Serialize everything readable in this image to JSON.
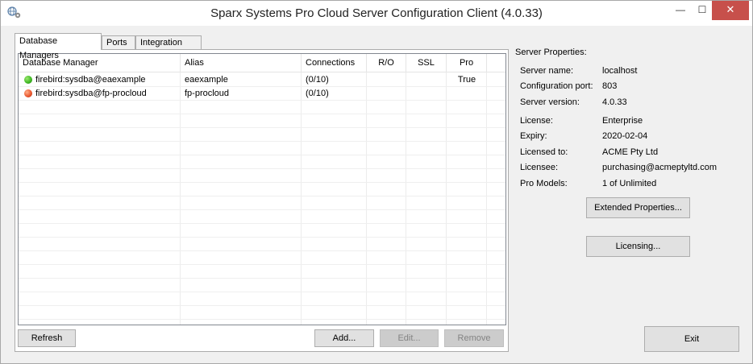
{
  "window": {
    "title": "Sparx Systems Pro Cloud Server Configuration Client (4.0.33)",
    "controls": {
      "minimize": "—",
      "maximize": "☐",
      "close": "✕"
    },
    "app_icon": "gear-globe-icon"
  },
  "tabs": [
    {
      "label": "Database Managers",
      "active": true
    },
    {
      "label": "Ports",
      "active": false
    },
    {
      "label": "Integration",
      "active": false
    }
  ],
  "grid": {
    "columns": [
      "Database Manager",
      "Alias",
      "Connections",
      "R/O",
      "SSL",
      "Pro"
    ],
    "rows": [
      {
        "status_color": "#3cb521",
        "manager": "firebird:sysdba@eaexample",
        "alias": "eaexample",
        "connections": "(0/10)",
        "ro": "",
        "ssl": "",
        "pro": "True"
      },
      {
        "status_color": "#e8532a",
        "manager": "firebird:sysdba@fp-procloud",
        "alias": "fp-procloud",
        "connections": "(0/10)",
        "ro": "",
        "ssl": "",
        "pro": ""
      }
    ]
  },
  "buttons": {
    "refresh": "Refresh",
    "add": "Add...",
    "edit": "Edit...",
    "remove": "Remove",
    "extended_properties": "Extended Properties...",
    "licensing": "Licensing...",
    "exit": "Exit"
  },
  "server_properties": {
    "title": "Server Properties:",
    "items": [
      {
        "label": "Server name:",
        "value": "localhost"
      },
      {
        "label": "Configuration port:",
        "value": "803"
      },
      {
        "label": "Server version:",
        "value": "4.0.33"
      },
      {
        "label": "License:",
        "value": "Enterprise"
      },
      {
        "label": "Expiry:",
        "value": "2020-02-04"
      },
      {
        "label": "Licensed to:",
        "value": "ACME Pty Ltd"
      },
      {
        "label": "Licensee:",
        "value": "purchasing@acmeptyltd.com"
      },
      {
        "label": "Pro Models:",
        "value": "1 of Unlimited"
      }
    ]
  }
}
